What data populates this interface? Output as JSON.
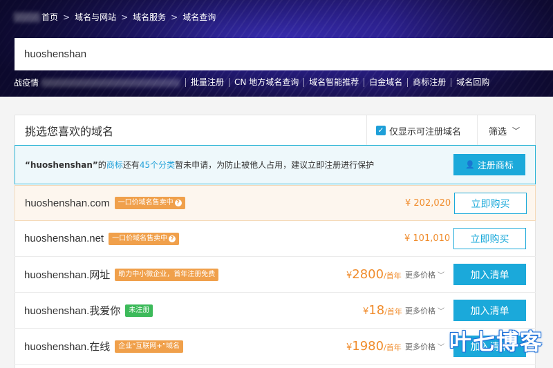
{
  "breadcrumb": {
    "items": [
      "首页",
      "域名与网站",
      "域名服务",
      "域名查询"
    ],
    "separator": ">"
  },
  "search": {
    "value": "huoshenshan",
    "placeholder": ""
  },
  "quick_links": {
    "prefix": "战疫情",
    "items": [
      "批量注册",
      "CN 地方域名查询",
      "域名智能推荐",
      "白金域名",
      "商标注册",
      "域名回购"
    ]
  },
  "panel": {
    "title": "挑选您喜欢的域名",
    "only_available_label": "仅显示可注册域名",
    "only_available_checked": true,
    "filter_label": "筛选"
  },
  "notice": {
    "quote_name": "“huoshenshan”",
    "text_1": "的",
    "link_trademark": "商标",
    "text_2": "还有",
    "link_categories": "45个分类",
    "text_3": "暂未申请，为防止被他人占用，建议立即注册进行保护",
    "button_label": "注册商标"
  },
  "domains": [
    {
      "name": "huoshenshan.com",
      "tag": "一口价域名售卖中",
      "price": "¥ 202,020",
      "button": "立即购买"
    },
    {
      "name": "huoshenshan.net",
      "tag": "一口价域名售卖中",
      "price": "¥ 101,010",
      "button": "立即购买"
    },
    {
      "name": "huoshenshan.网址",
      "tag": "助力中小微企业，首年注册免费",
      "price_symbol": "¥",
      "price": "2800",
      "unit": "/首年",
      "more": "更多价格",
      "button": "加入清单"
    },
    {
      "name": "huoshenshan.我爱你",
      "tag": "未注册",
      "price_symbol": "¥",
      "price": "18",
      "unit": "/首年",
      "more": "更多价格",
      "button": "加入清单"
    },
    {
      "name": "huoshenshan.在线",
      "tag": "企业“互联网+”域名",
      "price_symbol": "¥",
      "price": "1980",
      "unit": "/首年",
      "more": "更多价格",
      "button": "加入清单"
    }
  ],
  "watermark": "叶七博客",
  "colors": {
    "accent": "#1ba9da",
    "price": "#f08c2c",
    "tag_orange": "#f0a04b",
    "tag_green": "#3cba5a"
  }
}
